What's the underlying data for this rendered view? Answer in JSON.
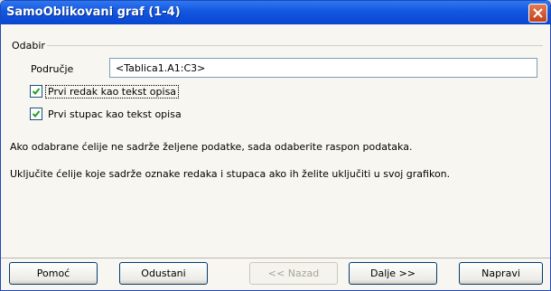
{
  "window": {
    "title": "SamoOblikovani graf (1-4)"
  },
  "selection": {
    "group_title": "Odabir",
    "range_label": "Područje",
    "range_value": "<Tablica1.A1:C3>",
    "first_row_label": "Prvi redak kao tekst opisa",
    "first_row_checked": true,
    "first_col_label": "Prvi stupac kao tekst opisa",
    "first_col_checked": true
  },
  "info": {
    "line1": "Ako odabrane ćelije ne sadrže željene podatke, sada odaberite raspon podataka.",
    "line2": "Uključite ćelije koje sadrže oznake redaka i stupaca ako ih želite uključiti u svoj grafikon."
  },
  "buttons": {
    "help": "Pomoć",
    "cancel": "Odustani",
    "back": "<< Nazad",
    "next": "Dalje >>",
    "finish": "Napravi"
  },
  "colors": {
    "titlebar": "#1256e0",
    "close": "#c3411c",
    "dialog_bg": "#f7f6f0"
  }
}
